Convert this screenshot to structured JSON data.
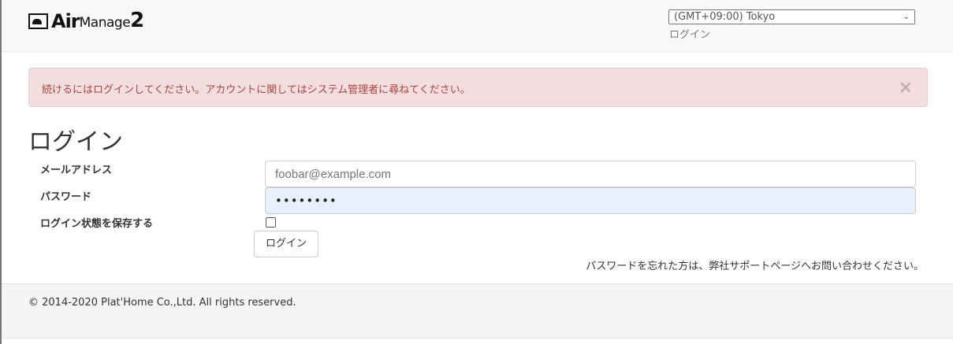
{
  "header": {
    "logo_text": "AirManage2",
    "logo_air": "Air",
    "logo_manage": "Manage",
    "logo_two": "2",
    "timezone": "(GMT+09:00) Tokyo",
    "login_link": "ログイン"
  },
  "alert": {
    "message": "続けるにはログインしてください。アカウントに関してはシステム管理者に尋ねてください。",
    "close": "×"
  },
  "form": {
    "title": "ログイン",
    "email_label": "メールアドレス",
    "email_placeholder": "foobar@example.com",
    "password_label": "パスワード",
    "password_value": "••••••••",
    "remember_label": "ログイン状態を保存する",
    "remember_checked": false,
    "submit": "ログイン",
    "forgot": "パスワードを忘れた方は、弊社サポートページへお問い合わせください。"
  },
  "footer": {
    "copyright": "© 2014-2020 Plat'Home Co.,Ltd. All rights reserved."
  }
}
